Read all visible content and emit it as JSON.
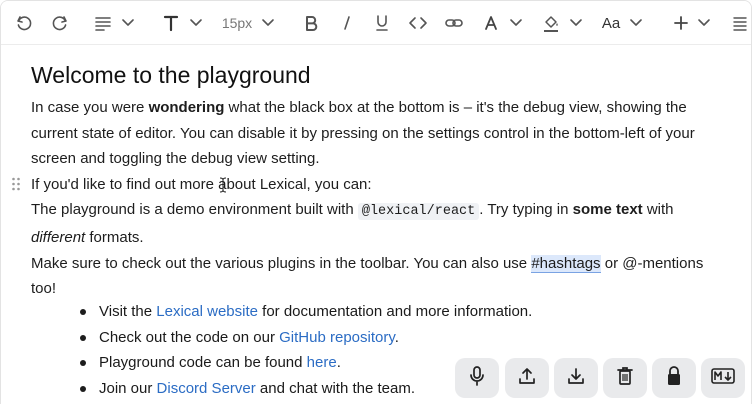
{
  "toolbar": {
    "block_icon": "paragraph-icon",
    "font_size": "15px",
    "text_format_label": "Aa"
  },
  "editor": {
    "heading": "Welcome to the playground",
    "p1": {
      "t1": "In case you were ",
      "b1": "wondering",
      "t2": " what the black box at the bottom is – it's the debug view, showing the current state of editor. You can disable it by pressing on the settings control in the bottom-left of your screen and toggling the debug view setting."
    },
    "p2": "If you'd like to find out more about Lexical, you can:",
    "p3": {
      "t1": "The playground is a demo environment built with ",
      "code": "@lexical/react",
      "t2": ". Try typing in ",
      "b1": "some text",
      "t3": " with ",
      "i1": "different",
      "t4": " formats."
    },
    "p4": {
      "t1": "Make sure to check out the various plugins in the toolbar. You can also use ",
      "hashtag": "#hashtags",
      "t2": " or @-mentions too!"
    },
    "list": [
      {
        "pre": "Visit the ",
        "link": "Lexical website",
        "post": " for documentation and more information."
      },
      {
        "pre": "Check out the code on our ",
        "link": "GitHub repository",
        "post": "."
      },
      {
        "pre": "Playground code can be found ",
        "link": "here",
        "post": "."
      },
      {
        "pre": "Join our ",
        "link": "Discord Server",
        "post": " and chat with the team."
      }
    ]
  },
  "actions": {
    "icons": [
      "microphone-icon",
      "upload-icon",
      "download-icon",
      "trash-icon",
      "lock-icon",
      "markdown-icon"
    ]
  },
  "colors": {
    "link": "#2b6cc4",
    "hashtag_bg": "#dce8fb",
    "action_bg": "#e9eaec"
  }
}
